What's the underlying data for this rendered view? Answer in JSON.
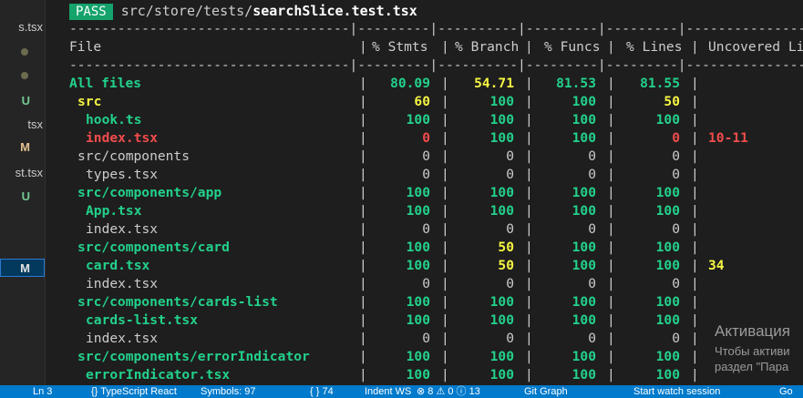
{
  "sidebar": {
    "rows": [
      {
        "label": "s.tsx",
        "badge": ""
      },
      {
        "label": "",
        "badge": "dot"
      },
      {
        "label": "",
        "badge": "dot"
      },
      {
        "label": "",
        "badge": "U"
      },
      {
        "label": "tsx",
        "badge": ""
      },
      {
        "label": "",
        "badge": "M"
      },
      {
        "label": "st.tsx",
        "badge": ""
      },
      {
        "label": "",
        "badge": "U"
      },
      {
        "label": "",
        "badge": "M"
      }
    ]
  },
  "terminal": {
    "status": "PASS",
    "test_dir": "src/store/tests/",
    "test_file": "searchSlice.test.tsx",
    "separator": "-----------------------------------|---------|----------|---------|---------|-------------------",
    "headers": [
      "File",
      "% Stmts",
      "% Branch",
      "% Funcs",
      "% Lines",
      "Uncovered Line #s"
    ],
    "rows": [
      {
        "file": "All files",
        "indent": 0,
        "color": "green",
        "bold": true,
        "stmts": "80.09",
        "branch": "54.71",
        "funcs": "81.53",
        "lines": "81.55",
        "uncovered": "",
        "c": [
          "green",
          "yellow",
          "green",
          "green"
        ]
      },
      {
        "file": "src",
        "indent": 1,
        "color": "yellow",
        "bold": true,
        "stmts": "60",
        "branch": "100",
        "funcs": "100",
        "lines": "50",
        "uncovered": "",
        "c": [
          "yellow",
          "green",
          "green",
          "yellow"
        ]
      },
      {
        "file": "hook.ts",
        "indent": 2,
        "color": "green",
        "bold": true,
        "stmts": "100",
        "branch": "100",
        "funcs": "100",
        "lines": "100",
        "uncovered": "",
        "c": [
          "green",
          "green",
          "green",
          "green"
        ]
      },
      {
        "file": "index.tsx",
        "indent": 2,
        "color": "red",
        "bold": true,
        "stmts": "0",
        "branch": "100",
        "funcs": "100",
        "lines": "0",
        "uncovered": "10-11",
        "c": [
          "red",
          "green",
          "green",
          "red"
        ],
        "uc": "red"
      },
      {
        "file": "src/components",
        "indent": 1,
        "color": "plain",
        "bold": false,
        "stmts": "0",
        "branch": "0",
        "funcs": "0",
        "lines": "0",
        "uncovered": "",
        "c": [
          "plain",
          "plain",
          "plain",
          "plain"
        ]
      },
      {
        "file": "types.tsx",
        "indent": 2,
        "color": "plain",
        "bold": false,
        "stmts": "0",
        "branch": "0",
        "funcs": "0",
        "lines": "0",
        "uncovered": "",
        "c": [
          "plain",
          "plain",
          "plain",
          "plain"
        ]
      },
      {
        "file": "src/components/app",
        "indent": 1,
        "color": "green",
        "bold": true,
        "stmts": "100",
        "branch": "100",
        "funcs": "100",
        "lines": "100",
        "uncovered": "",
        "c": [
          "green",
          "green",
          "green",
          "green"
        ]
      },
      {
        "file": "App.tsx",
        "indent": 2,
        "color": "green",
        "bold": true,
        "stmts": "100",
        "branch": "100",
        "funcs": "100",
        "lines": "100",
        "uncovered": "",
        "c": [
          "green",
          "green",
          "green",
          "green"
        ]
      },
      {
        "file": "index.tsx",
        "indent": 2,
        "color": "plain",
        "bold": false,
        "stmts": "0",
        "branch": "0",
        "funcs": "0",
        "lines": "0",
        "uncovered": "",
        "c": [
          "plain",
          "plain",
          "plain",
          "plain"
        ]
      },
      {
        "file": "src/components/card",
        "indent": 1,
        "color": "green",
        "bold": true,
        "stmts": "100",
        "branch": "50",
        "funcs": "100",
        "lines": "100",
        "uncovered": "",
        "c": [
          "green",
          "yellow",
          "green",
          "green"
        ]
      },
      {
        "file": "card.tsx",
        "indent": 2,
        "color": "green",
        "bold": true,
        "stmts": "100",
        "branch": "50",
        "funcs": "100",
        "lines": "100",
        "uncovered": "34",
        "c": [
          "green",
          "yellow",
          "green",
          "green"
        ],
        "uc": "yellow"
      },
      {
        "file": "index.tsx",
        "indent": 2,
        "color": "plain",
        "bold": false,
        "stmts": "0",
        "branch": "0",
        "funcs": "0",
        "lines": "0",
        "uncovered": "",
        "c": [
          "plain",
          "plain",
          "plain",
          "plain"
        ]
      },
      {
        "file": "src/components/cards-list",
        "indent": 1,
        "color": "green",
        "bold": true,
        "stmts": "100",
        "branch": "100",
        "funcs": "100",
        "lines": "100",
        "uncovered": "",
        "c": [
          "green",
          "green",
          "green",
          "green"
        ]
      },
      {
        "file": "cards-list.tsx",
        "indent": 2,
        "color": "green",
        "bold": true,
        "stmts": "100",
        "branch": "100",
        "funcs": "100",
        "lines": "100",
        "uncovered": "",
        "c": [
          "green",
          "green",
          "green",
          "green"
        ]
      },
      {
        "file": "index.tsx",
        "indent": 2,
        "color": "plain",
        "bold": false,
        "stmts": "0",
        "branch": "0",
        "funcs": "0",
        "lines": "0",
        "uncovered": "",
        "c": [
          "plain",
          "plain",
          "plain",
          "plain"
        ]
      },
      {
        "file": "src/components/errorIndicator",
        "indent": 1,
        "color": "green",
        "bold": true,
        "stmts": "100",
        "branch": "100",
        "funcs": "100",
        "lines": "100",
        "uncovered": "",
        "c": [
          "green",
          "green",
          "green",
          "green"
        ]
      },
      {
        "file": "errorIndicator.tsx",
        "indent": 2,
        "color": "green",
        "bold": true,
        "stmts": "100",
        "branch": "100",
        "funcs": "100",
        "lines": "100",
        "uncovered": "",
        "c": [
          "green",
          "green",
          "green",
          "green"
        ]
      }
    ]
  },
  "activation": {
    "title": "Активация",
    "line1": "Чтобы активи",
    "line2": "раздел \"Пара"
  },
  "statusbar": {
    "items": [
      "Ln 3",
      "{} TypeScript React",
      "Symbols: 97",
      "{ } 74",
      "Indent WS",
      "⊗ 8  ⚠ 0  ⓘ 13",
      "Git Graph",
      "Start watch session",
      "Go"
    ]
  },
  "colors": {
    "green": "#23d18b",
    "yellow": "#f5f543",
    "red": "#f14c4c",
    "pass_bg": "#13a36b",
    "statusbar": "#007acc"
  }
}
